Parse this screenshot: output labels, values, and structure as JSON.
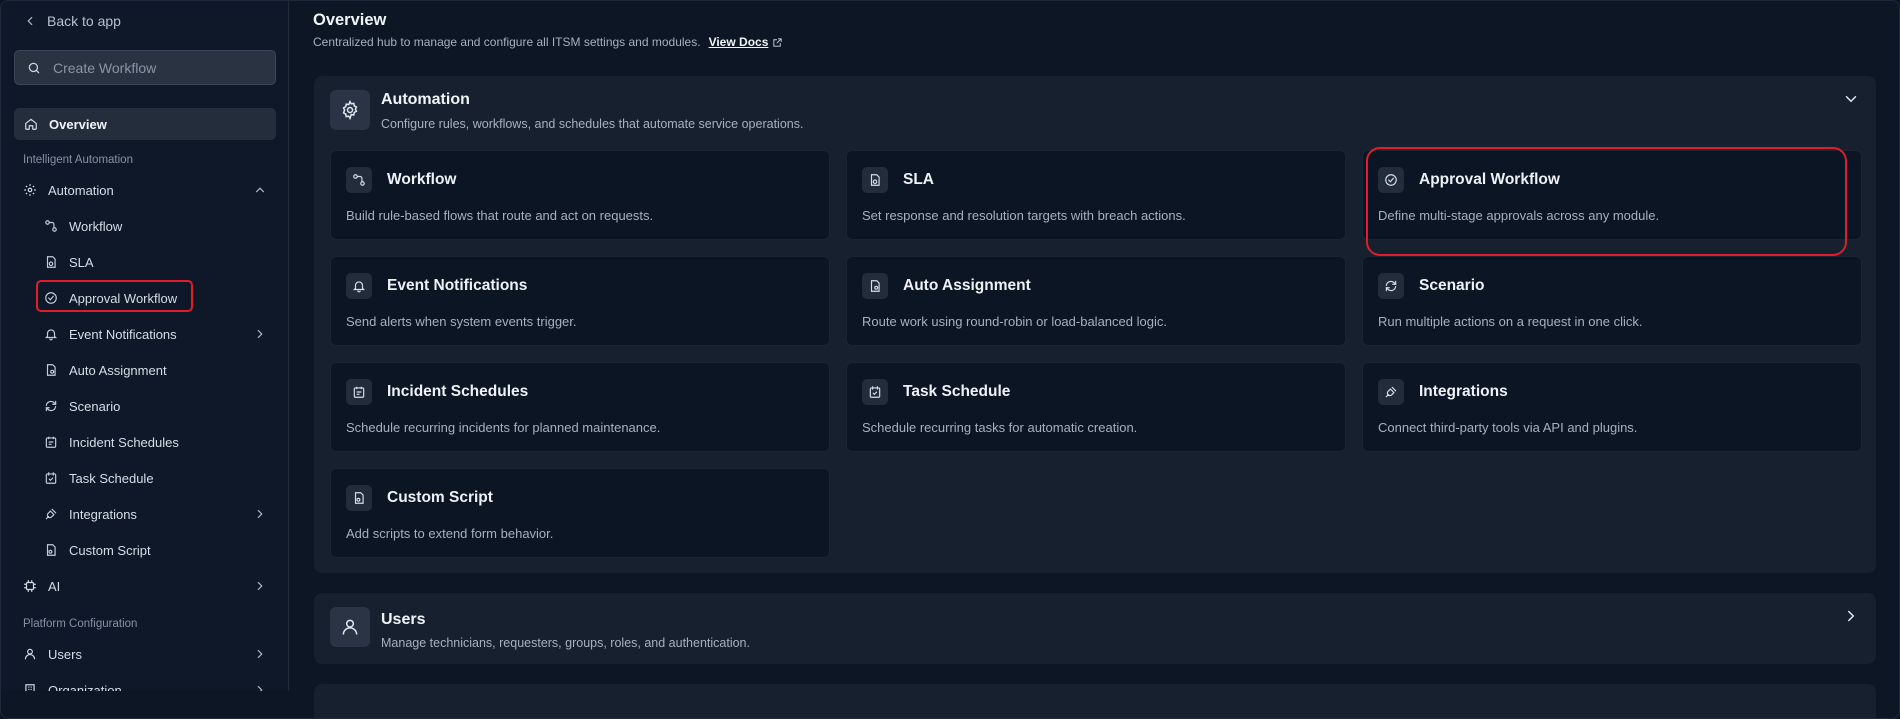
{
  "sidebar": {
    "back_label": "Back to app",
    "search_placeholder": "Create Workflow",
    "overview_label": "Overview",
    "section_intelligent": "Intelligent Automation",
    "automation_label": "Automation",
    "items": [
      {
        "label": "Workflow",
        "icon": "workflow-icon"
      },
      {
        "label": "SLA",
        "icon": "sla-icon"
      },
      {
        "label": "Approval Workflow",
        "icon": "check-circle-icon"
      },
      {
        "label": "Event Notifications",
        "icon": "bell-icon"
      },
      {
        "label": "Auto Assignment",
        "icon": "assignment-icon"
      },
      {
        "label": "Scenario",
        "icon": "refresh-icon"
      },
      {
        "label": "Incident Schedules",
        "icon": "calendar-icon"
      },
      {
        "label": "Task Schedule",
        "icon": "calendar-check-icon"
      },
      {
        "label": "Integrations",
        "icon": "plug-icon"
      },
      {
        "label": "Custom Script",
        "icon": "script-icon"
      }
    ],
    "ai_label": "AI",
    "section_platform": "Platform Configuration",
    "users_label": "Users",
    "organization_label": "Organization"
  },
  "header": {
    "title": "Overview",
    "subtitle": "Centralized hub to manage and configure all ITSM settings and modules.",
    "docs_label": "View Docs"
  },
  "automation_panel": {
    "title": "Automation",
    "description": "Configure rules, workflows, and schedules that automate service operations.",
    "cards": [
      {
        "title": "Workflow",
        "description": "Build rule-based flows that route and act on requests."
      },
      {
        "title": "SLA",
        "description": "Set response and resolution targets with breach actions."
      },
      {
        "title": "Approval Workflow",
        "description": "Define multi-stage approvals across any module."
      },
      {
        "title": "Event Notifications",
        "description": "Send alerts when system events trigger."
      },
      {
        "title": "Auto Assignment",
        "description": "Route work using round-robin or load-balanced logic."
      },
      {
        "title": "Scenario",
        "description": "Run multiple actions on a request in one click."
      },
      {
        "title": "Incident Schedules",
        "description": "Schedule recurring incidents for planned maintenance."
      },
      {
        "title": "Task Schedule",
        "description": "Schedule recurring tasks for automatic creation."
      },
      {
        "title": "Integrations",
        "description": "Connect third-party tools via API and plugins."
      },
      {
        "title": "Custom Script",
        "description": "Add scripts to extend form behavior."
      }
    ]
  },
  "users_panel": {
    "title": "Users",
    "description": "Manage technicians, requesters, groups, roles, and authentication."
  },
  "colors": {
    "background": "#0c1624",
    "panel": "#17202f",
    "card": "#0c1524",
    "highlight": "#e11d2a"
  }
}
